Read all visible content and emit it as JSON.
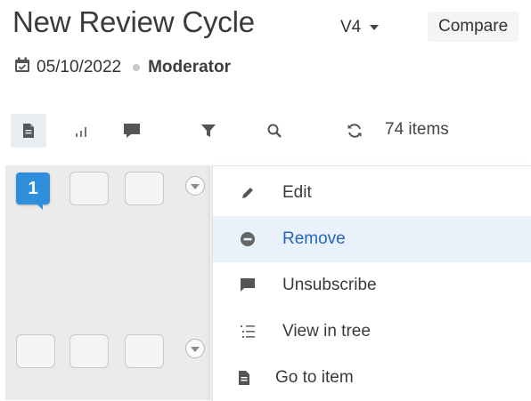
{
  "header": {
    "title": "New Review Cycle",
    "version_label": "V4",
    "compare_label": "Compare",
    "date": "05/10/2022",
    "role": "Moderator"
  },
  "toolbar": {
    "items_count": "74 items",
    "icons": [
      "document-icon",
      "bar-chart-icon",
      "comment-icon",
      "filter-icon",
      "search-icon",
      "refresh-icon"
    ]
  },
  "grid": {
    "badge_number": "1"
  },
  "context_menu": {
    "items": [
      {
        "label": "Edit",
        "icon": "pencil-icon"
      },
      {
        "label": "Remove",
        "icon": "minus-circle-icon",
        "active": true
      },
      {
        "label": "Unsubscribe",
        "icon": "flag-icon"
      },
      {
        "label": "View in tree",
        "icon": "tree-list-icon"
      },
      {
        "label": "Go to item",
        "icon": "document-icon"
      }
    ]
  },
  "colors": {
    "accent": "#2f8fdc",
    "menu_active_bg": "#e9f2fb",
    "menu_active_text": "#2566b8",
    "grid_bg": "#ebebeb"
  }
}
